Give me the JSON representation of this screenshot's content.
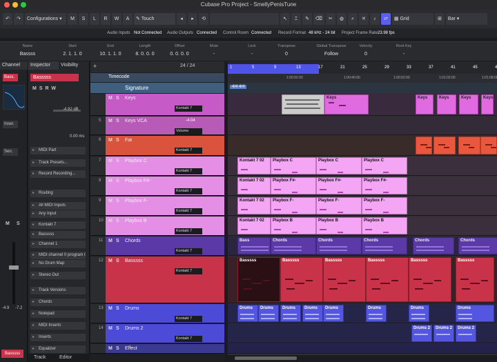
{
  "window": {
    "title": "Cubase Pro Project - SmellyPenisTune"
  },
  "toolbar": {
    "configurations": "Configurations",
    "modes": [
      "M",
      "S",
      "L",
      "R",
      "W",
      "A"
    ],
    "automation_mode": "Touch",
    "snap_type": "Grid",
    "quantize": "Bar"
  },
  "status": {
    "audio_inputs_label": "Audio Inputs",
    "audio_inputs_value": "Not Connected",
    "audio_outputs_label": "Audio Outputs",
    "audio_outputs_value": "Connected",
    "control_room_label": "Control Room",
    "control_room_value": "Connected",
    "record_format_label": "Record Format",
    "record_format_value": "48 kHz - 24 bit",
    "frame_rate_label": "Project Frame Rate",
    "frame_rate_value": "23.98 fps"
  },
  "infoline": {
    "columns": [
      {
        "label": "Name",
        "value": "Bassss"
      },
      {
        "label": "Start",
        "value": "2. 1. 1.   0"
      },
      {
        "label": "End",
        "value": "10. 1. 1.   0"
      },
      {
        "label": "Length",
        "value": "8. 0. 0.   0"
      },
      {
        "label": "Offset",
        "value": "0. 0. 0.   0"
      },
      {
        "label": "Mute",
        "value": "-"
      },
      {
        "label": "Lock",
        "value": "-"
      },
      {
        "label": "Transpose",
        "value": "0"
      },
      {
        "label": "Global Transpose",
        "value": "Follow"
      },
      {
        "label": "Velocity",
        "value": "0"
      },
      {
        "label": "Root Key",
        "value": "-"
      }
    ]
  },
  "channel": {
    "tab": "Channel",
    "track_name": "Bass.",
    "insert_label": "Inser.",
    "send_label": "Sen.",
    "meter_left": "-4.9",
    "meter_right": "-7.2",
    "footer_name": "Basssss",
    "fader_level": 0.62
  },
  "inspector": {
    "tabs": [
      "Inspector",
      "Visibility"
    ],
    "track_name": "Basssss",
    "volume": "-4.92 dB",
    "pan": "0.00 ms",
    "items": [
      {
        "icon": "midi-icon",
        "label": "MIDI Part"
      },
      {
        "icon": "preset-icon",
        "label": "Track Presets..."
      },
      {
        "icon": "record-icon",
        "label": "Record Recording..."
      },
      {
        "icon": "routing-icon",
        "label": "Routing"
      },
      {
        "icon": "input-icon",
        "label": "All MIDI Inputs"
      },
      {
        "icon": "input-icon",
        "label": "Any Input"
      },
      {
        "icon": "instrument-icon",
        "label": "Kontakt 7"
      },
      {
        "icon": "output-icon",
        "label": "Basssss"
      },
      {
        "icon": "channel-icon",
        "label": "Channel 1"
      },
      {
        "icon": "program-icon",
        "label": "MIDI channel 0 program 0"
      },
      {
        "icon": "drum-icon",
        "label": "No Drum Map"
      },
      {
        "icon": "stereo-icon",
        "label": "Stereo Out"
      },
      {
        "icon": "versions-icon",
        "label": "Track Versions"
      },
      {
        "icon": "chords-icon",
        "label": "Chords"
      },
      {
        "icon": "notepad-icon",
        "label": "Notepad"
      },
      {
        "icon": "midi-inserts-icon",
        "label": "MIDI Inserts"
      },
      {
        "icon": "inserts-icon",
        "label": "Inserts"
      },
      {
        "icon": "equalizer-icon",
        "label": "Equalizer"
      }
    ],
    "bottom_tabs": [
      "Track",
      "Editor"
    ]
  },
  "trackhead": {
    "count": "24 / 24",
    "timecode_label": "Timecode",
    "signature_label": "Signature",
    "signature_value": "4/4   4/4"
  },
  "tracks": [
    {
      "num": "",
      "name": "Keys",
      "color": "#c65ac6",
      "instrument": "Kontakt 7"
    },
    {
      "num": "5",
      "name": "Keys VCA",
      "color": "#b85bb8",
      "instrument": "Volume",
      "value": "-4.04"
    },
    {
      "num": "6",
      "name": "Fat",
      "color": "#d9533d",
      "instrument": "Kontakt 7"
    },
    {
      "num": "7",
      "name": "Playbox C",
      "color": "#e58ee5",
      "instrument": "Kontakt 7"
    },
    {
      "num": "8",
      "name": "Playbox F#-",
      "color": "#e58ee5",
      "instrument": "Kontakt 7"
    },
    {
      "num": "9",
      "name": "Playbox F-",
      "color": "#e58ee5",
      "instrument": "Kontakt 7"
    },
    {
      "num": "10",
      "name": "Playbox B",
      "color": "#e58ee5",
      "instrument": "Kontakt 7"
    },
    {
      "num": "11",
      "name": "Chords",
      "color": "#5b3aa8",
      "instrument": "Kontakt 7"
    },
    {
      "num": "12",
      "name": "Basssss",
      "color": "#c9334a",
      "instrument": "Kontakt 7"
    },
    {
      "num": "13",
      "name": "Drums",
      "color": "#4c4bd8",
      "instrument": "Kontakt 7"
    },
    {
      "num": "14",
      "name": "Drums 2",
      "color": "#4c4bd8",
      "instrument": "Kontakt 7"
    },
    {
      "num": "",
      "name": "Effect",
      "color": "#3a3a90",
      "instrument": ""
    }
  ],
  "ruler": {
    "bars": [
      "1",
      "5",
      "9",
      "13",
      "17",
      "21",
      "25",
      "29",
      "33",
      "37",
      "41",
      "45",
      "49"
    ],
    "times": [
      "1:00:02:00",
      "1:00:40:00",
      "1:00:52:00",
      "1:01:02:00",
      "1:01:08:00"
    ]
  },
  "clips": {
    "playbox_names": [
      "Kontakt 7 02",
      "Playbox C",
      "Playbox F#-",
      "Playbox F-",
      "Playbox B"
    ],
    "chords": [
      "Bass",
      "Chords",
      "Chords",
      "Chords",
      "Chords",
      "Chords"
    ],
    "bass": [
      "Basssss",
      "Basssss",
      "Basssss",
      "Basssss",
      "Basssss",
      "Basssss"
    ],
    "drums": [
      "Drums",
      "Drums",
      "Drums",
      "Drums",
      "Drums",
      "Drums",
      "Drums",
      "Drums"
    ],
    "drums2": [
      "Drums 2",
      "Drums 2",
      "Drums 2"
    ],
    "keys": "Keys"
  },
  "colors": {
    "accent": "#5a5ff0",
    "bass_track": "#c9334a",
    "playbox": "#f4a6f4",
    "drums": "#5456e0"
  }
}
